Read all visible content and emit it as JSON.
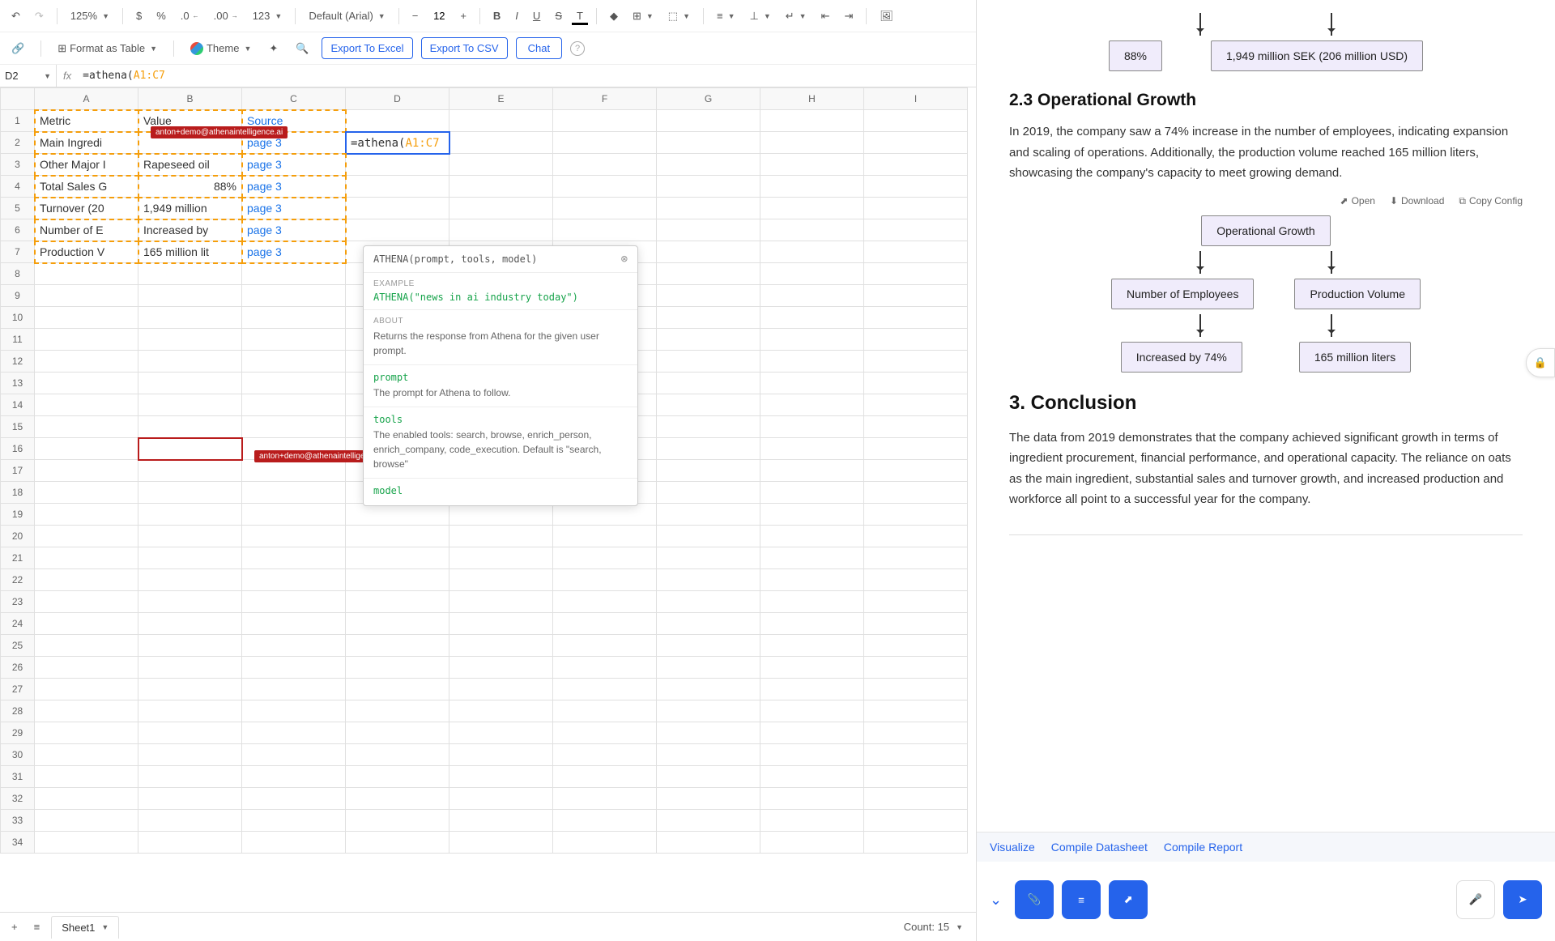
{
  "toolbar": {
    "zoom": "125%",
    "currency": "$",
    "percent": "%",
    "dec_inc": ".0",
    "dec_dec": ".00",
    "num_format": "123",
    "font": "Default (Arial)",
    "font_size": "12",
    "format_table": "Format as Table",
    "theme": "Theme",
    "export_excel": "Export To Excel",
    "export_csv": "Export To CSV",
    "chat": "Chat"
  },
  "formula_bar": {
    "cell_ref": "D2",
    "formula_prefix": "=athena(",
    "formula_range": "A1:C7"
  },
  "columns": [
    "A",
    "B",
    "C",
    "D",
    "E",
    "F",
    "G",
    "H",
    "I"
  ],
  "rows_count": 34,
  "cells": {
    "r1": {
      "A": "Metric",
      "B": "Value",
      "C": "Source"
    },
    "r2": {
      "A": "Main Ingredi",
      "B": "",
      "C": "page 3",
      "D_prefix": "=athena(",
      "D_range": "A1:C7"
    },
    "r3": {
      "A": "Other Major I",
      "B": "Rapeseed oil",
      "C": "page 3"
    },
    "r4": {
      "A": "Total Sales G",
      "B": "88%",
      "C": "page 3"
    },
    "r5": {
      "A": "Turnover (20",
      "B": "1,949 million",
      "C": "page 3"
    },
    "r6": {
      "A": "Number of E",
      "B": "Increased by",
      "C": "page 3"
    },
    "r7": {
      "A": "Production V",
      "B": "165 million lit",
      "C": "page 3"
    }
  },
  "user_tag": "anton+demo@athenaintelligence.ai",
  "tooltip": {
    "signature": "ATHENA(prompt, tools, model)",
    "example_label": "EXAMPLE",
    "example": "ATHENA(\"news in ai industry today\")",
    "about_label": "ABOUT",
    "about": "Returns the response from Athena for the given user prompt.",
    "params": [
      {
        "name": "prompt",
        "desc": "The prompt for Athena to follow."
      },
      {
        "name": "tools",
        "desc": "The enabled tools: search, browse, enrich_person, enrich_company, code_execution. Default is \"search, browse\""
      },
      {
        "name": "model",
        "desc": ""
      }
    ]
  },
  "sheet": {
    "name": "Sheet1",
    "count_label": "Count: 15"
  },
  "doc": {
    "top_nodes": {
      "left": "88%",
      "right": "1,949 million SEK (206 million USD)"
    },
    "h23": "2.3 Operational Growth",
    "p23": "In 2019, the company saw a 74% increase in the number of employees, indicating expansion and scaling of operations. Additionally, the production volume reached 165 million liters, showcasing the company's capacity to meet growing demand.",
    "actions": {
      "open": "Open",
      "download": "Download",
      "copy": "Copy Config"
    },
    "diagram": {
      "root": "Operational Growth",
      "mid_left": "Number of Employees",
      "mid_right": "Production Volume",
      "leaf_left": "Increased by 74%",
      "leaf_right": "165 million liters"
    },
    "h3": "3. Conclusion",
    "p3": "The data from 2019 demonstrates that the company achieved significant growth in terms of ingredient procurement, financial performance, and operational capacity. The reliance on oats as the main ingredient, substantial sales and turnover growth, and increased production and workforce all point to a successful year for the company."
  },
  "chat": {
    "visualize": "Visualize",
    "compile_ds": "Compile Datasheet",
    "compile_rep": "Compile Report"
  }
}
